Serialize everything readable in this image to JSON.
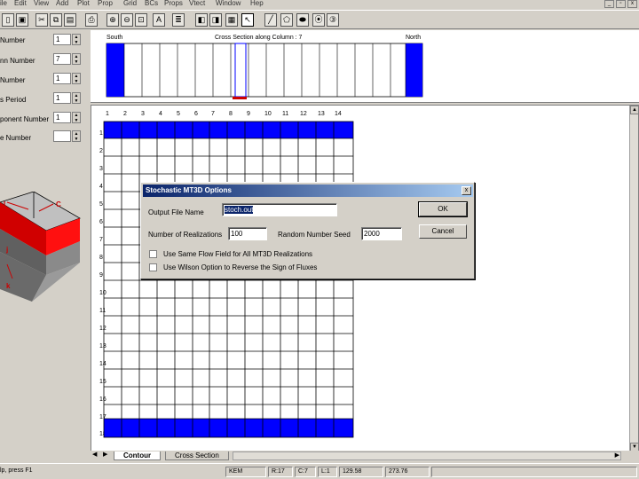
{
  "menu": [
    "ile",
    "Edit",
    "View",
    "Add",
    "Plot",
    "Prop",
    "Grid",
    "BCs",
    "Props",
    "Vtect",
    "Window",
    "Hep"
  ],
  "window_controls": [
    "_",
    "▫",
    "x"
  ],
  "toolbar_icons": [
    "new-file-icon",
    "save-icon",
    "cut-icon",
    "copy-icon",
    "paste-icon",
    "print-icon",
    "zoom-in-icon",
    "zoom-out-icon",
    "zoom-extent-icon",
    "text-icon",
    "report-icon",
    "layer-color-icon",
    "layer-copy-icon",
    "display-icon",
    "select-arrow-icon",
    "draw-line-icon",
    "draw-polygon-icon",
    "draw-ellipse-icon",
    "well-icon",
    "run-icon"
  ],
  "left_panel": {
    "fields": [
      {
        "label": "Number",
        "value": "1"
      },
      {
        "label": "nn Number",
        "value": "7"
      },
      {
        "label": " Number",
        "value": "1"
      },
      {
        "label": "s Period",
        "value": "1"
      },
      {
        "label": "ponent Number",
        "value": "1"
      },
      {
        "label": "e Number",
        "value": ""
      }
    ],
    "cube_labels": {
      "top_left": "I",
      "top_right": "C",
      "side": "j",
      "bottom": "k"
    }
  },
  "cross_section": {
    "left_label": "South",
    "title": "Cross Section along Column : 7",
    "right_label": "North"
  },
  "grid": {
    "column_labels": [
      "1",
      "2",
      "3",
      "4",
      "5",
      "6",
      "7",
      "8",
      "9",
      "10",
      "11",
      "12",
      "13",
      "14"
    ],
    "row_labels": [
      "1",
      "2",
      "3",
      "4",
      "5",
      "6",
      "7",
      "8",
      "9",
      "10",
      "11",
      "12",
      "13",
      "14",
      "15",
      "16",
      "17",
      "18"
    ]
  },
  "tabs": [
    {
      "label": "Contour",
      "active": true
    },
    {
      "label": "Cross Section",
      "active": false
    }
  ],
  "status": {
    "left": "lp, press F1",
    "mode": "KEM",
    "row": "R:17",
    "col": "C:7",
    "layer": "L:1",
    "x": "129.58",
    "y": "273.76"
  },
  "dialog": {
    "title": "Stochastic MT3D Options",
    "close_label": "x",
    "output_file_label": "Output File Name",
    "output_file_value": "stoch.out",
    "realizations_label": "Number of Realizations",
    "realizations_value": "100",
    "seed_label": "Random Number Seed",
    "seed_value": "2000",
    "checkbox1_label": "Use Same Flow Field for All MT3D Realizations",
    "checkbox2_label": "Use Wilson Option to Reverse the Sign of Fluxes",
    "ok_label": "OK",
    "cancel_label": "Cancel"
  },
  "colors": {
    "accent": "#0000ff",
    "title_bar": "#0a246a",
    "cube_red": "#e00000"
  }
}
